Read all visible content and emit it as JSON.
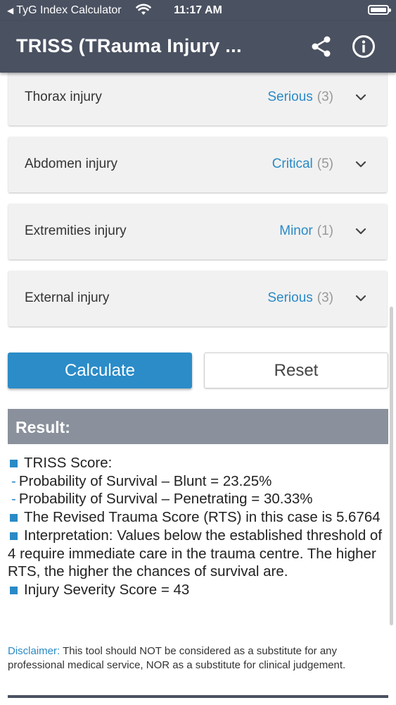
{
  "status_bar": {
    "back_app": "TyG Index Calculator",
    "time": "11:17 AM"
  },
  "nav": {
    "title": "TRISS (TRauma Injury ...",
    "share_icon": "share-icon",
    "info_icon": "info-icon"
  },
  "injuries": [
    {
      "label": "Thorax injury",
      "value": "Serious",
      "score": "(3)"
    },
    {
      "label": "Abdomen injury",
      "value": "Critical",
      "score": "(5)"
    },
    {
      "label": "Extremities injury",
      "value": "Minor",
      "score": "(1)"
    },
    {
      "label": "External injury",
      "value": "Serious",
      "score": "(3)"
    }
  ],
  "buttons": {
    "calculate": "Calculate",
    "reset": "Reset"
  },
  "result": {
    "heading": "Result:",
    "triss_label": "TRISS Score:",
    "blunt": "Probability of Survival – Blunt = 23.25%",
    "penetrating": "Probability of Survival – Penetrating = 30.33%",
    "rts": "The Revised Trauma Score (RTS) in this case is 5.6764",
    "interpretation": "Interpretation: Values below the established threshold of 4 require immediate care in the trauma centre. The higher RTS, the higher the chances of survival are.",
    "iss": "Injury Severity Score = 43"
  },
  "disclaimer": {
    "label": "Disclaimer:",
    "text": " This tool should NOT be considered as a substitute for any professional medical service, NOR as a substitute for clinical judgement."
  },
  "colors": {
    "header": "#4a5161",
    "accent": "#2a8ac6",
    "result_header": "#8a919c"
  }
}
